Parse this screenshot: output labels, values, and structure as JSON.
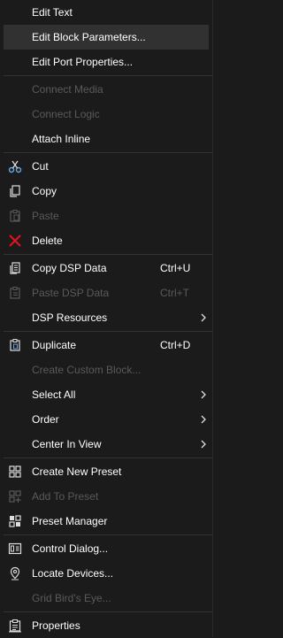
{
  "menu": {
    "items": [
      {
        "label": "Edit Text"
      },
      {
        "label": "Edit Block Parameters..."
      },
      {
        "label": "Edit Port Properties..."
      },
      {
        "label": "Connect Media"
      },
      {
        "label": "Connect Logic"
      },
      {
        "label": "Attach Inline"
      },
      {
        "label": "Cut",
        "icon": "scissors-icon"
      },
      {
        "label": "Copy",
        "icon": "copy-icon"
      },
      {
        "label": "Paste",
        "icon": "paste-icon"
      },
      {
        "label": "Delete",
        "icon": "delete-x-icon"
      },
      {
        "label": "Copy DSP Data",
        "shortcut": "Ctrl+U",
        "icon": "copy-data-icon"
      },
      {
        "label": "Paste DSP Data",
        "shortcut": "Ctrl+T",
        "icon": "paste-data-icon"
      },
      {
        "label": "DSP Resources",
        "submenu": true
      },
      {
        "label": "Duplicate",
        "shortcut": "Ctrl+D",
        "icon": "duplicate-icon"
      },
      {
        "label": "Create Custom Block..."
      },
      {
        "label": "Select All",
        "submenu": true
      },
      {
        "label": "Order",
        "submenu": true
      },
      {
        "label": "Center In View",
        "submenu": true
      },
      {
        "label": "Create New Preset",
        "icon": "create-preset-icon"
      },
      {
        "label": "Add To Preset",
        "icon": "add-preset-icon"
      },
      {
        "label": "Preset Manager",
        "icon": "preset-manager-icon"
      },
      {
        "label": "Control Dialog...",
        "icon": "control-dialog-icon"
      },
      {
        "label": "Locate Devices...",
        "icon": "location-pin-icon"
      },
      {
        "label": "Grid Bird's Eye..."
      },
      {
        "label": "Properties",
        "icon": "properties-icon"
      }
    ]
  },
  "colors": {
    "background": "#1b1b1b",
    "hover": "#313131",
    "text": "#ffffff",
    "disabled_text": "#5a5a5a",
    "separator": "#333333",
    "delete_red": "#e81123",
    "cut_blue": "#6aa7e8"
  }
}
